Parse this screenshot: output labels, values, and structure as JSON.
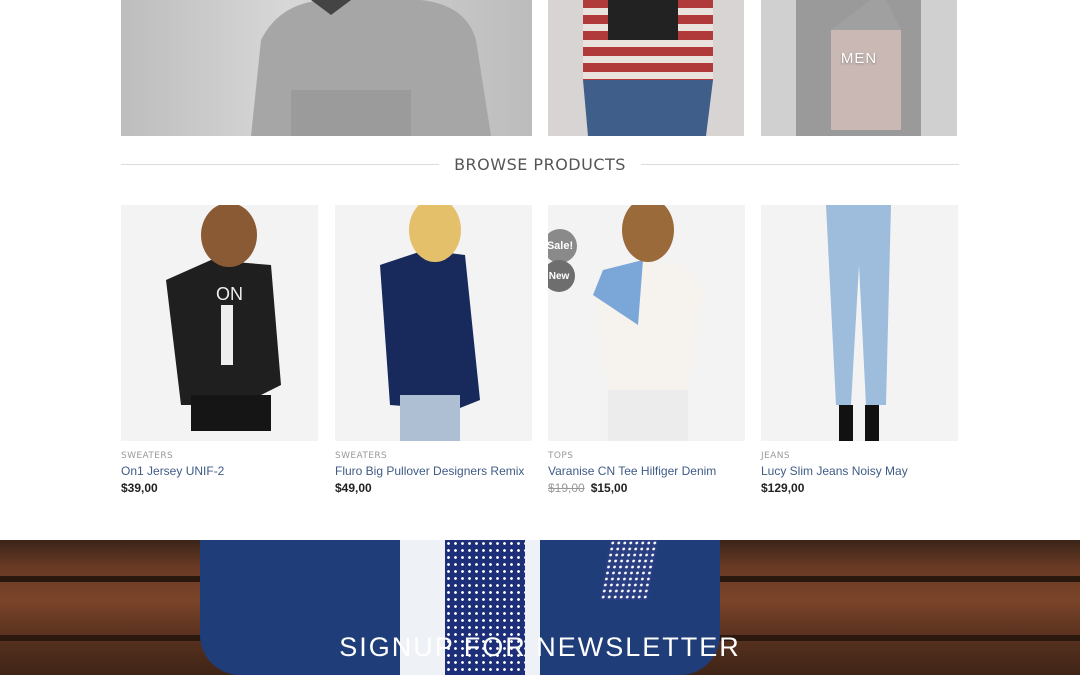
{
  "categories": [
    {
      "label": ""
    },
    {
      "label": ""
    },
    {
      "label": "MEN"
    }
  ],
  "section_title": "BROWSE PRODUCTS",
  "products": [
    {
      "category": "SWEATERS",
      "name": "On1 Jersey UNIF-2",
      "price": "$39,00",
      "old_price": ""
    },
    {
      "category": "SWEATERS",
      "name": "Fluro Big Pullover Designers Remix",
      "price": "$49,00",
      "old_price": ""
    },
    {
      "category": "TOPS",
      "name": "Varanise CN Tee Hilfiger Denim",
      "price": "$15,00",
      "old_price": "$19,00",
      "badges": [
        "Sale!",
        "New"
      ]
    },
    {
      "category": "JEANS",
      "name": "Lucy Slim Jeans Noisy May",
      "price": "$129,00",
      "old_price": ""
    }
  ],
  "newsletter": {
    "title": "SIGNUP FOR NEWSLETTER"
  }
}
